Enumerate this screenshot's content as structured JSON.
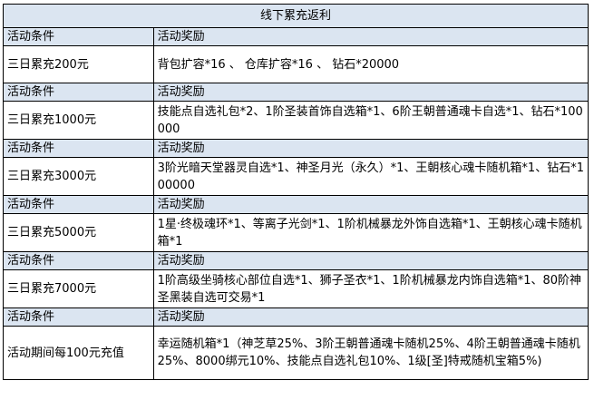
{
  "table": {
    "title": "线下累充返利",
    "header_condition": "活动条件",
    "header_reward": "活动奖励",
    "rows": [
      {
        "condition": "三日累充200元",
        "reward": "背包扩容*16 、 仓库扩容*16 、 钻石*20000"
      },
      {
        "condition": "三日累充1000元",
        "reward": "技能点自选礼包*2、1阶圣装首饰自选箱*1、6阶王朝普通魂卡自选*1、钻石*100000"
      },
      {
        "condition": "三日累充3000元",
        "reward": "3阶光暗天堂器灵自选*1、神圣月光（永久）*1、王朝核心魂卡随机箱*1、钻石*100000"
      },
      {
        "condition": "三日累充5000元",
        "reward": "1星·终极魂环*1、等离子光剑*1、1阶机械暴龙外饰自选箱*1、王朝核心魂卡随机箱*1"
      },
      {
        "condition": "三日累充7000元",
        "reward": "1阶高级坐骑核心部位自选*1、狮子圣衣*1、1阶机械暴龙内饰自选箱*1、80阶神圣黑装自选可交易*1"
      },
      {
        "condition": "活动期间每100元充值",
        "reward": "幸运随机箱*1（神芝草25%、3阶王朝普通魂卡随机25%、4阶王朝普通魂卡随机25%、8000绑元10%、技能点自选礼包10%、1级[圣]特戒随机宝箱5%)"
      }
    ]
  }
}
